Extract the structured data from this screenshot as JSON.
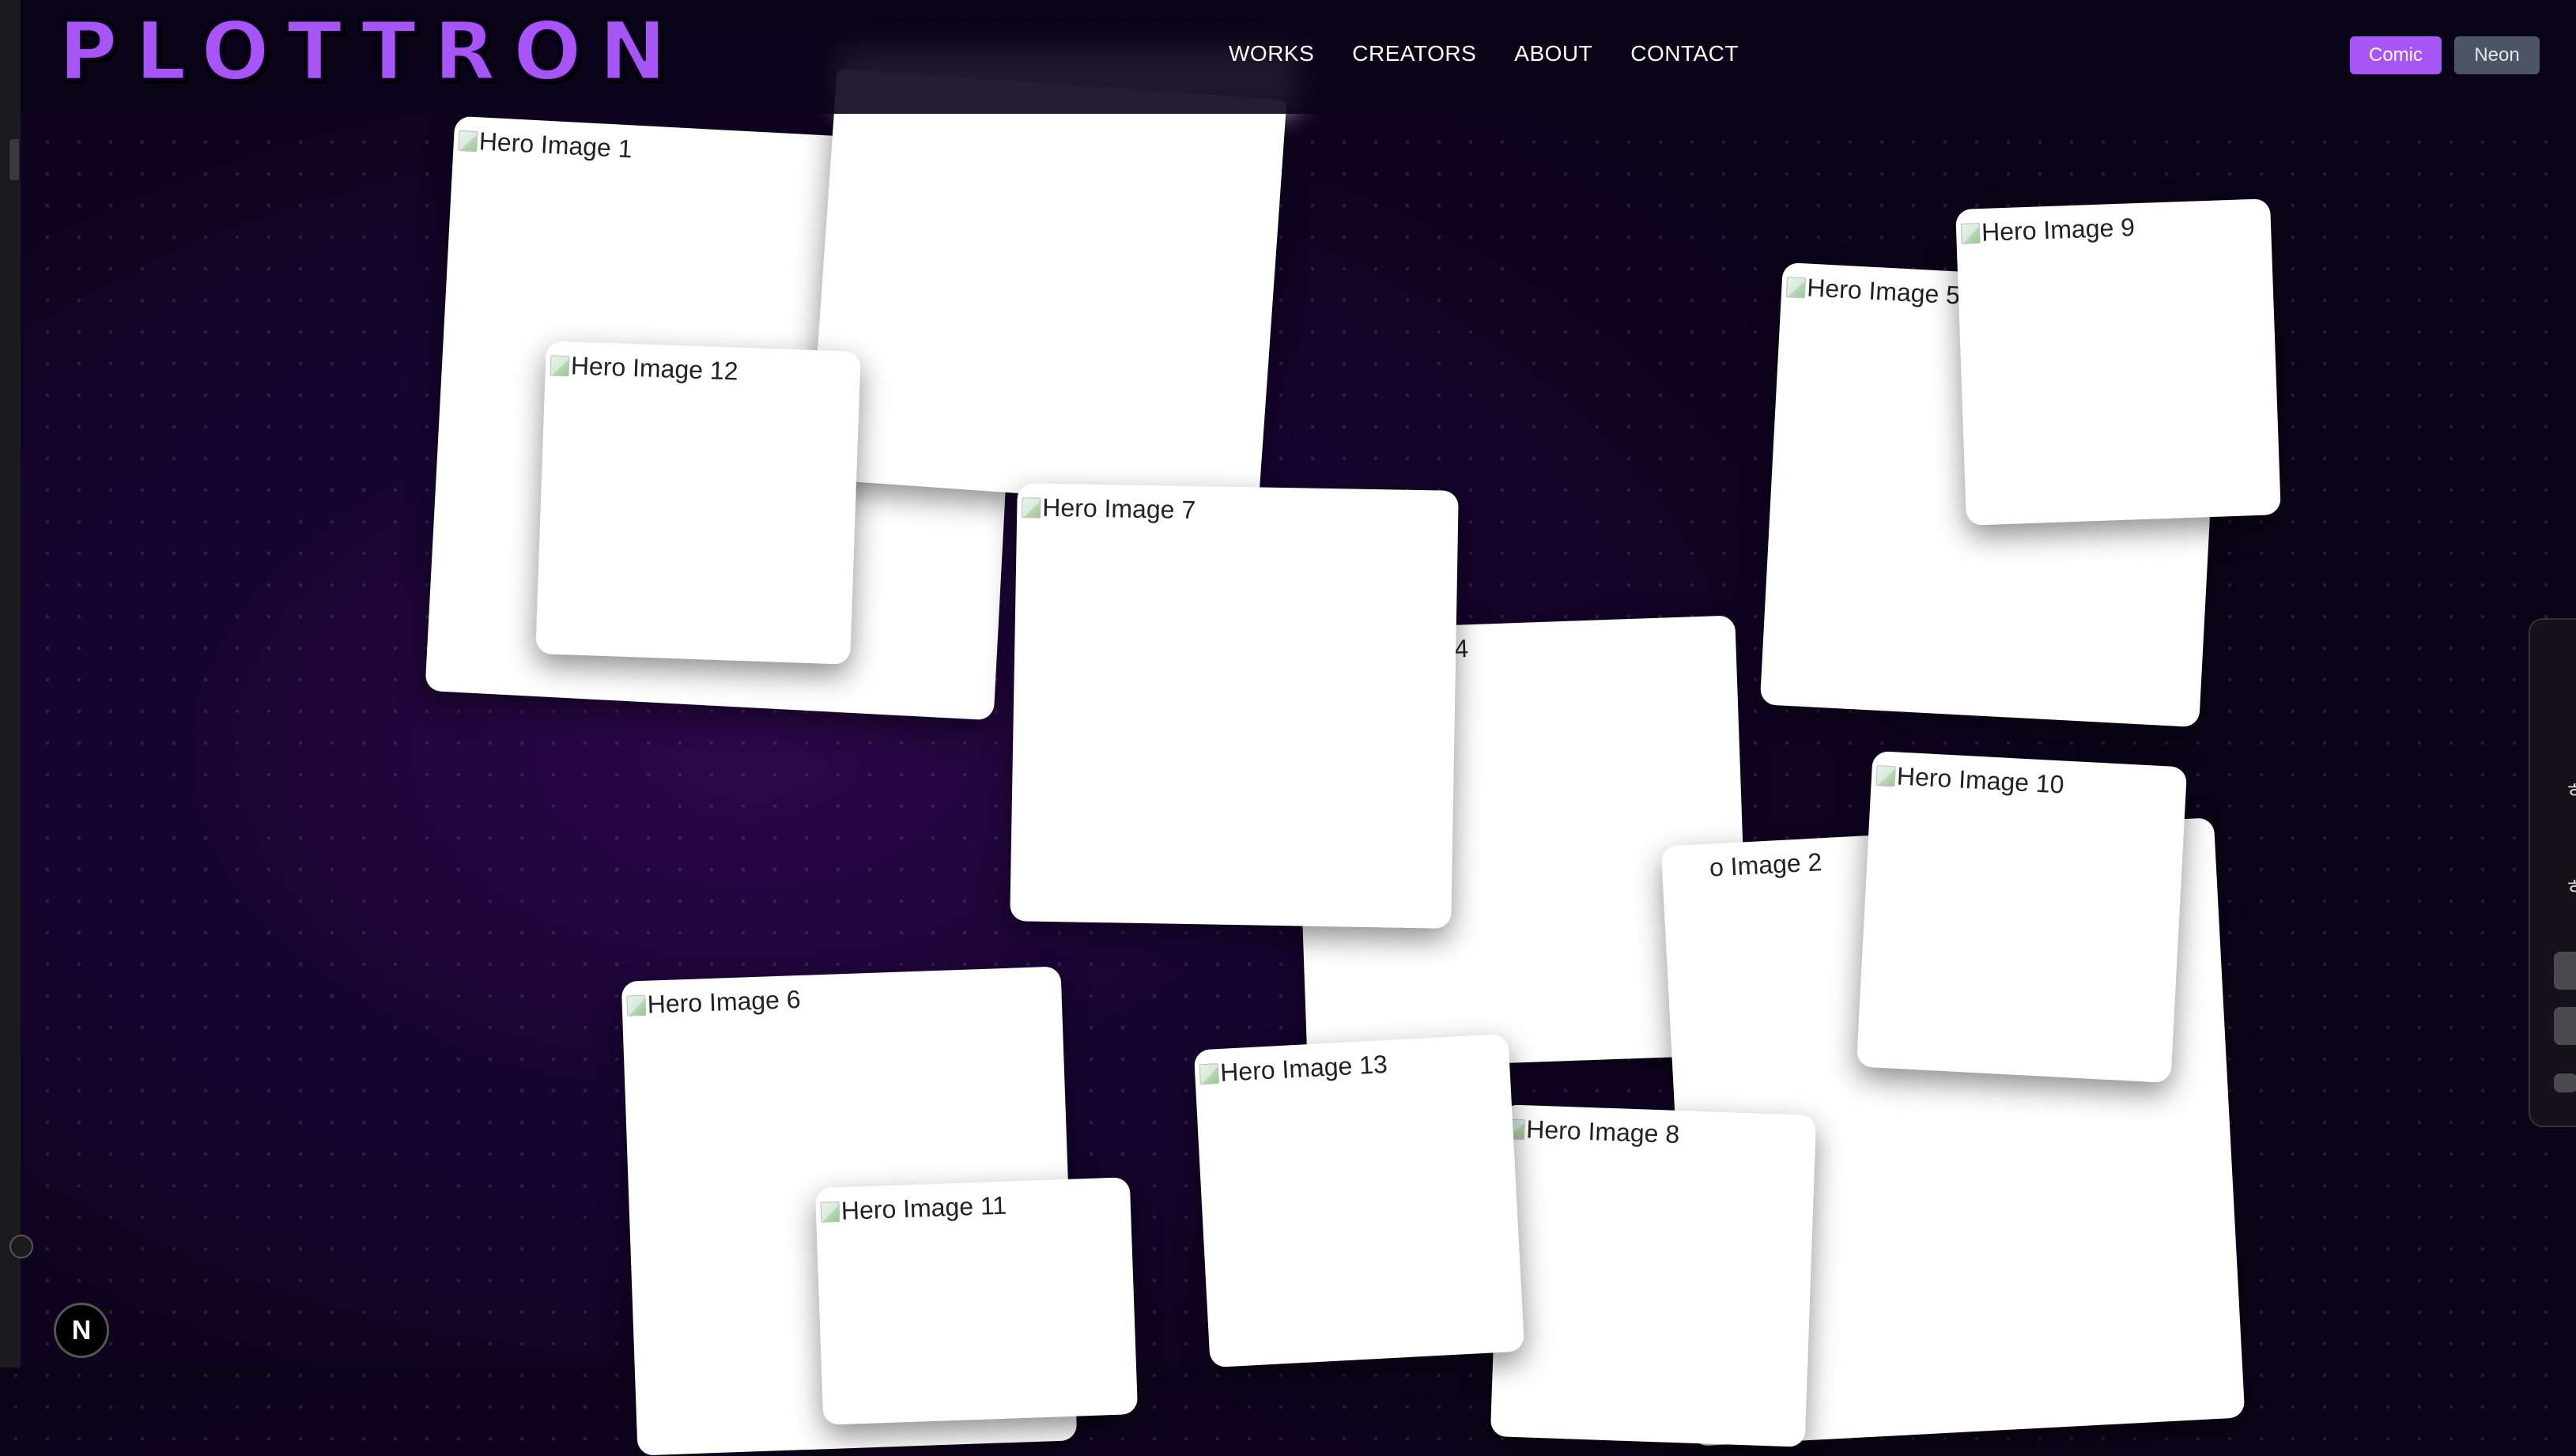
{
  "app": {
    "logo_text": "PLOTTRON"
  },
  "nav": {
    "items": [
      "WORKS",
      "CREATORS",
      "ABOUT",
      "CONTACT"
    ]
  },
  "theme": {
    "comic_label": "Comic",
    "neon_label": "Neon",
    "accent_color": "#a855f7"
  },
  "cards": [
    {
      "label": "Hero Image 1"
    },
    {
      "label": ""
    },
    {
      "label": "Hero Image 5"
    },
    {
      "label": "Hero Image 9"
    },
    {
      "label": "Hero Image 12"
    },
    {
      "label": "4"
    },
    {
      "label": "o Image 2"
    },
    {
      "label": "Hero Image 7"
    },
    {
      "label": "Hero Image 10"
    },
    {
      "label": "Hero Image 6"
    },
    {
      "label": "Hero Image 8"
    },
    {
      "label": "Hero Image 11"
    },
    {
      "label": "Hero Image 13"
    }
  ],
  "side_panel": {
    "char1": "ㅎ",
    "char2": "ㅎ"
  },
  "badge": {
    "icon": "next-logo-icon",
    "label": "N"
  }
}
